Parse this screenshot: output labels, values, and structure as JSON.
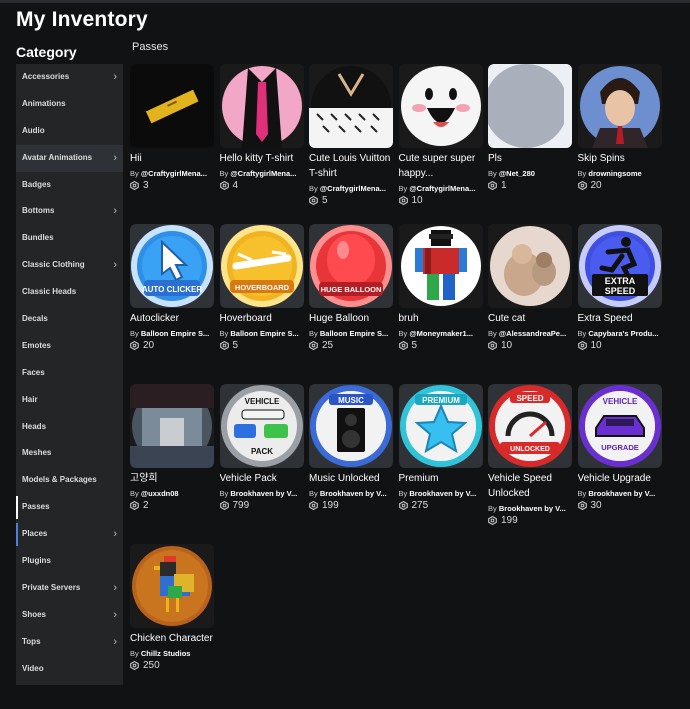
{
  "header": {
    "title": "My Inventory"
  },
  "sidebar": {
    "title": "Category",
    "items": [
      {
        "label": "Accessories",
        "chevron": true
      },
      {
        "label": "Animations",
        "chevron": false
      },
      {
        "label": "Audio",
        "chevron": false
      },
      {
        "label": "Avatar Animations",
        "chevron": true
      },
      {
        "label": "Badges",
        "chevron": false
      },
      {
        "label": "Bottoms",
        "chevron": true
      },
      {
        "label": "Bundles",
        "chevron": false
      },
      {
        "label": "Classic Clothing",
        "chevron": true
      },
      {
        "label": "Classic Heads",
        "chevron": false
      },
      {
        "label": "Decals",
        "chevron": false
      },
      {
        "label": "Emotes",
        "chevron": false
      },
      {
        "label": "Faces",
        "chevron": false
      },
      {
        "label": "Hair",
        "chevron": false
      },
      {
        "label": "Heads",
        "chevron": false
      },
      {
        "label": "Meshes",
        "chevron": false
      },
      {
        "label": "Models & Packages",
        "chevron": false
      },
      {
        "label": "Passes",
        "chevron": false
      },
      {
        "label": "Places",
        "chevron": true
      },
      {
        "label": "Plugins",
        "chevron": false
      },
      {
        "label": "Private Servers",
        "chevron": true
      },
      {
        "label": "Shoes",
        "chevron": true
      },
      {
        "label": "Tops",
        "chevron": true
      },
      {
        "label": "Video",
        "chevron": false
      }
    ]
  },
  "main": {
    "section_title": "Passes",
    "by_label": "By",
    "items": [
      {
        "name": "Hii",
        "creator": "@CraftygirlMena...",
        "price": "3",
        "thumb": "gold-bar"
      },
      {
        "name": "Hello kitty T-shirt",
        "creator": "@CraftygirlMena...",
        "price": "4",
        "thumb": "pink-shirt"
      },
      {
        "name": "Cute Louis Vuitton T-shirt",
        "creator": "@CraftygirlMena...",
        "price": "5",
        "thumb": "lv-shirt"
      },
      {
        "name": "Cute super super happy...",
        "creator": "@CraftygirlMena...",
        "price": "10",
        "thumb": "happy-face"
      },
      {
        "name": "Pls",
        "creator": "@Net_280",
        "price": "1",
        "thumb": "grey-circle"
      },
      {
        "name": "Skip Spins",
        "creator": "drowningsome",
        "price": "20",
        "thumb": "anime-char"
      },
      {
        "name": "Autoclicker",
        "creator": "Balloon Empire S...",
        "price": "20",
        "thumb": "autoclicker"
      },
      {
        "name": "Hoverboard",
        "creator": "Balloon Empire S...",
        "price": "5",
        "thumb": "hoverboard"
      },
      {
        "name": "Huge Balloon",
        "creator": "Balloon Empire S...",
        "price": "25",
        "thumb": "balloon"
      },
      {
        "name": "bruh",
        "creator": "@Moneymaker1...",
        "price": "5",
        "thumb": "avatar"
      },
      {
        "name": "Cute cat",
        "creator": "@AlessandreaPe...",
        "price": "10",
        "thumb": "cat"
      },
      {
        "name": "Extra Speed",
        "creator": "Capybara's Produ...",
        "price": "10",
        "thumb": "extra-speed"
      },
      {
        "name": "고양희",
        "creator": "@uxxdn08",
        "price": "2",
        "thumb": "photo"
      },
      {
        "name": "Vehicle Pack",
        "creator": "Brookhaven by V...",
        "price": "799",
        "thumb": "vehicle-pack"
      },
      {
        "name": "Music Unlocked",
        "creator": "Brookhaven by V...",
        "price": "199",
        "thumb": "music"
      },
      {
        "name": "Premium",
        "creator": "Brookhaven by V...",
        "price": "275",
        "thumb": "premium"
      },
      {
        "name": "Vehicle Speed Unlocked",
        "creator": "Brookhaven by V...",
        "price": "199",
        "thumb": "speed"
      },
      {
        "name": "Vehicle Upgrade",
        "creator": "Brookhaven by V...",
        "price": "30",
        "thumb": "vehicle-upgrade"
      },
      {
        "name": "Chicken Character",
        "creator": "Chillz Studios",
        "price": "250",
        "thumb": "chicken"
      }
    ],
    "thumb_text": {
      "autoclicker": "AUTO CLICKER",
      "hoverboard": "HOVERBOARD",
      "balloon": "HUGE BALLOON",
      "extra_speed_1": "EXTRA",
      "extra_speed_2": "SPEED",
      "vehicle_pack_1": "VEHICLE",
      "vehicle_pack_2": "PACK",
      "music": "MUSIC",
      "premium": "PREMIUM",
      "speed_1": "SPEED",
      "speed_2": "UNLOCKED",
      "vehicle_upgrade_1": "VEHICLE",
      "vehicle_upgrade_2": "UPGRADE"
    }
  },
  "colors": {
    "background": "#111214",
    "sidebar": "#232527",
    "card": "#2f3236",
    "accent": "#4f7fd8"
  }
}
